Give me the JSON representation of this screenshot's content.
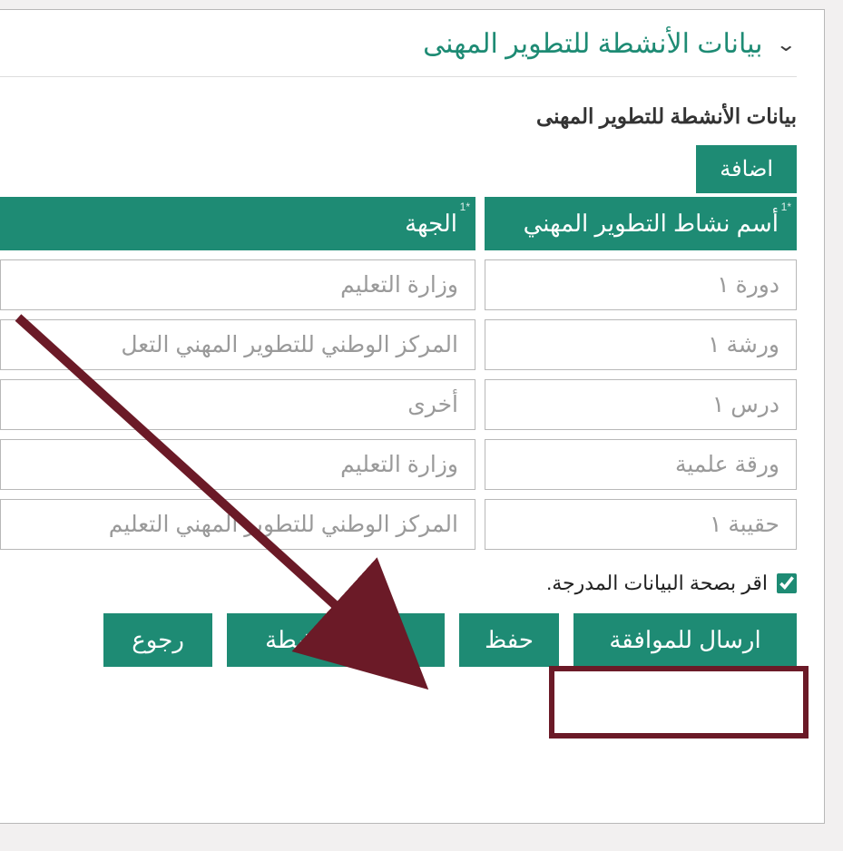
{
  "section": {
    "title": "بيانات الأنشطة للتطوير المهنى",
    "subtitle": "بيانات الأنشطة للتطوير المهنى"
  },
  "toolbar": {
    "add_label": "اضافة"
  },
  "table": {
    "headers": {
      "name": "أسم نشاط التطوير المهني",
      "org": "الجهة",
      "req": "*1"
    },
    "rows": [
      {
        "name": "دورة ١",
        "org": "وزارة التعليم"
      },
      {
        "name": "ورشة ١",
        "org": "المركز الوطني للتطوير المهني التعل"
      },
      {
        "name": "درس ١",
        "org": "أخرى"
      },
      {
        "name": "ورقة علمية",
        "org": "وزارة التعليم"
      },
      {
        "name": "حقيبة ١",
        "org": "المركز الوطني للتطوير المهني التعليم"
      }
    ]
  },
  "confirm": {
    "label": "اقر بصحة البيانات المدرجة."
  },
  "buttons": {
    "submit": "ارسال للموافقة",
    "save": "حفظ",
    "check": "فحص الأنشطة",
    "back": "رجوع"
  }
}
